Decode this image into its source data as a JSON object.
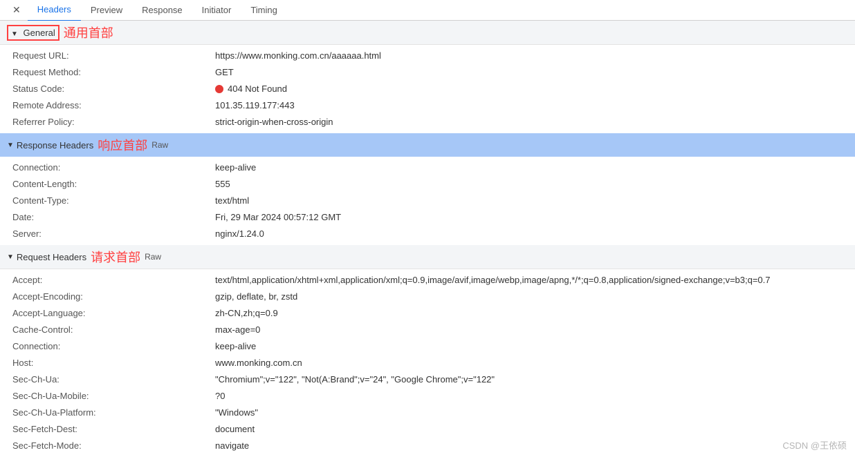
{
  "tabs": {
    "close": "✕",
    "items": [
      "Headers",
      "Preview",
      "Response",
      "Initiator",
      "Timing"
    ],
    "active_index": 0
  },
  "sections": {
    "general": {
      "title": "General",
      "annotation": "通用首部",
      "rows": [
        {
          "label": "Request URL:",
          "value": "https://www.monking.com.cn/aaaaaa.html"
        },
        {
          "label": "Request Method:",
          "value": "GET"
        },
        {
          "label": "Status Code:",
          "value": "404 Not Found",
          "status_dot": true
        },
        {
          "label": "Remote Address:",
          "value": "101.35.119.177:443"
        },
        {
          "label": "Referrer Policy:",
          "value": "strict-origin-when-cross-origin"
        }
      ]
    },
    "response_headers": {
      "title": "Response Headers",
      "annotation": "响应首部",
      "raw": "Raw",
      "rows": [
        {
          "label": "Connection:",
          "value": "keep-alive"
        },
        {
          "label": "Content-Length:",
          "value": "555"
        },
        {
          "label": "Content-Type:",
          "value": "text/html"
        },
        {
          "label": "Date:",
          "value": "Fri, 29 Mar 2024 00:57:12 GMT"
        },
        {
          "label": "Server:",
          "value": "nginx/1.24.0"
        }
      ]
    },
    "request_headers": {
      "title": "Request Headers",
      "annotation": "请求首部",
      "raw": "Raw",
      "rows": [
        {
          "label": "Accept:",
          "value": "text/html,application/xhtml+xml,application/xml;q=0.9,image/avif,image/webp,image/apng,*/*;q=0.8,application/signed-exchange;v=b3;q=0.7"
        },
        {
          "label": "Accept-Encoding:",
          "value": "gzip, deflate, br, zstd"
        },
        {
          "label": "Accept-Language:",
          "value": "zh-CN,zh;q=0.9"
        },
        {
          "label": "Cache-Control:",
          "value": "max-age=0"
        },
        {
          "label": "Connection:",
          "value": "keep-alive"
        },
        {
          "label": "Host:",
          "value": "www.monking.com.cn"
        },
        {
          "label": "Sec-Ch-Ua:",
          "value": "\"Chromium\";v=\"122\", \"Not(A:Brand\";v=\"24\", \"Google Chrome\";v=\"122\""
        },
        {
          "label": "Sec-Ch-Ua-Mobile:",
          "value": "?0"
        },
        {
          "label": "Sec-Ch-Ua-Platform:",
          "value": "\"Windows\""
        },
        {
          "label": "Sec-Fetch-Dest:",
          "value": "document"
        },
        {
          "label": "Sec-Fetch-Mode:",
          "value": "navigate"
        }
      ]
    }
  },
  "watermark": "CSDN @王依硕"
}
